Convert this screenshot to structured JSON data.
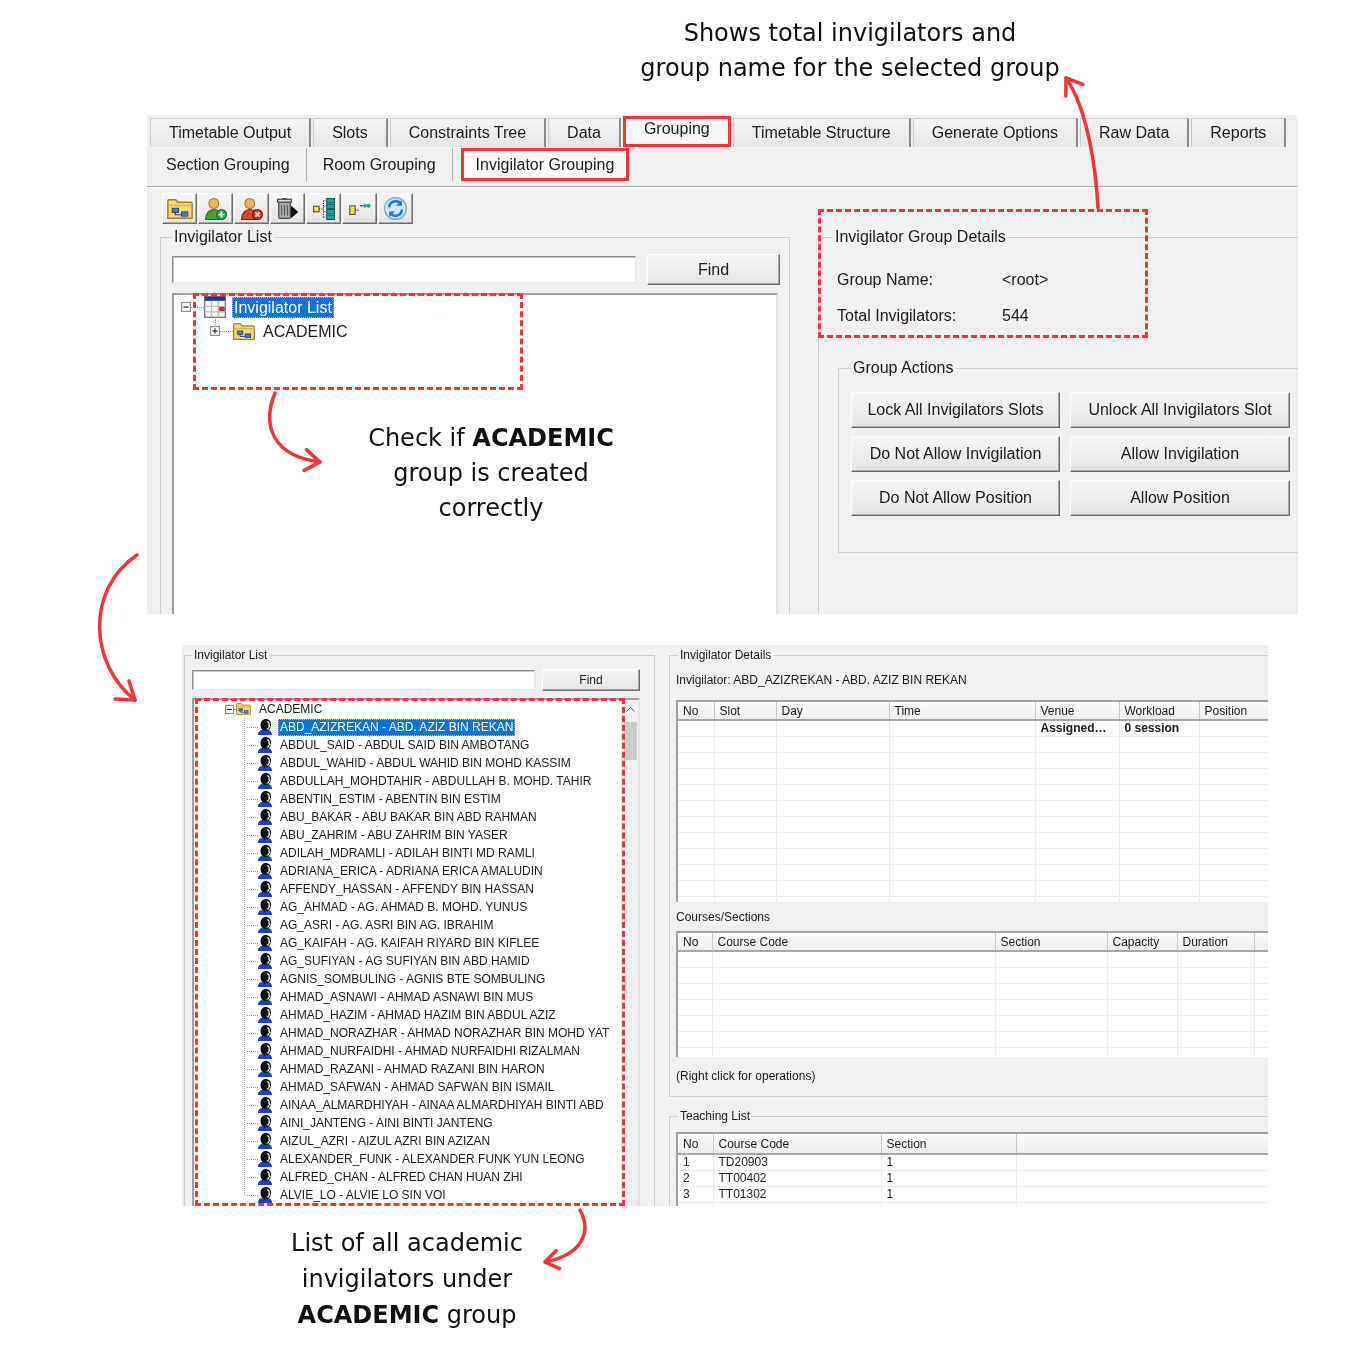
{
  "callout_top": {
    "lines": [
      "Shows total invigilators and",
      "group name for the selected group"
    ]
  },
  "screen_1": {
    "tabs": [
      {
        "label": "Timetable Output",
        "selected": false,
        "highlighted": false
      },
      {
        "label": "Slots",
        "selected": false,
        "highlighted": false
      },
      {
        "label": "Constraints Tree",
        "selected": false,
        "highlighted": false
      },
      {
        "label": "Data",
        "selected": false,
        "highlighted": false
      },
      {
        "label": "Grouping",
        "selected": true,
        "highlighted": true
      },
      {
        "label": "Timetable Structure",
        "selected": false,
        "highlighted": false
      },
      {
        "label": "Generate Options",
        "selected": false,
        "highlighted": false
      },
      {
        "label": "Raw Data",
        "selected": false,
        "highlighted": false
      },
      {
        "label": "Reports",
        "selected": false,
        "highlighted": false
      }
    ],
    "subtabs": [
      {
        "label": "Section Grouping",
        "selected": false,
        "highlighted": false
      },
      {
        "label": "Room Grouping",
        "selected": false,
        "highlighted": false
      },
      {
        "label": "Invigilator Grouping",
        "selected": true,
        "highlighted": true
      }
    ],
    "invigilator_list": {
      "title": "Invigilator List",
      "find_button": "Find",
      "tree_highlighted": true,
      "tree": [
        {
          "kind": "list",
          "label": "Invigilator List",
          "selected": true,
          "expanded": true,
          "children": [
            {
              "kind": "group",
              "label": "ACADEMIC",
              "selected": false,
              "expanded": false
            }
          ]
        }
      ],
      "callout": {
        "lines": [
          "Check if **ACADEMIC**",
          "group is created",
          "correctly"
        ]
      }
    },
    "group_details": {
      "title": "Invigilator Group Details",
      "highlighted": true,
      "fields": [
        {
          "label": "Group Name:",
          "value": "<root>"
        },
        {
          "label": "Total Invigilators:",
          "value": "544"
        }
      ]
    },
    "group_actions": {
      "title": "Group Actions",
      "buttons": [
        "Lock All Invigilators Slots",
        "Unlock All Invigilators Slot",
        "Do Not Allow Invigilation",
        "Allow Invigilation",
        "Do Not Allow Position",
        "Allow Position"
      ]
    }
  },
  "screen_2": {
    "invigilator_list": {
      "title": "Invigilator List",
      "find_button": "Find",
      "tree_highlighted": true,
      "tree": [
        {
          "kind": "group",
          "label": "ACADEMIC",
          "selected": false,
          "expanded": true,
          "children": [
            {
              "kind": "person",
              "label": "ABD_AZIZREKAN - ABD. AZIZ BIN REKAN",
              "selected": true
            },
            {
              "kind": "person",
              "label": "ABDUL_SAID - ABDUL SAID BIN AMBOTANG",
              "selected": false
            },
            {
              "kind": "person",
              "label": "ABDUL_WAHID - ABDUL WAHID BIN MOHD KASSIM",
              "selected": false
            },
            {
              "kind": "person",
              "label": "ABDULLAH_MOHDTAHIR - ABDULLAH B. MOHD. TAHIR",
              "selected": false
            },
            {
              "kind": "person",
              "label": "ABENTIN_ESTIM - ABENTIN BIN ESTIM",
              "selected": false
            },
            {
              "kind": "person",
              "label": "ABU_BAKAR - ABU BAKAR BIN ABD RAHMAN",
              "selected": false
            },
            {
              "kind": "person",
              "label": "ABU_ZAHRIM - ABU ZAHRIM BIN YASER",
              "selected": false
            },
            {
              "kind": "person",
              "label": "ADILAH_MDRAMLI - ADILAH BINTI MD RAMLI",
              "selected": false
            },
            {
              "kind": "person",
              "label": "ADRIANA_ERICA - ADRIANA ERICA AMALUDIN",
              "selected": false
            },
            {
              "kind": "person",
              "label": "AFFENDY_HASSAN - AFFENDY BIN HASSAN",
              "selected": false
            },
            {
              "kind": "person",
              "label": "AG_AHMAD - AG. AHMAD B. MOHD. YUNUS",
              "selected": false
            },
            {
              "kind": "person",
              "label": "AG_ASRI - AG. ASRI BIN AG. IBRAHIM",
              "selected": false
            },
            {
              "kind": "person",
              "label": "AG_KAIFAH - AG. KAIFAH RIYARD BIN KIFLEE",
              "selected": false
            },
            {
              "kind": "person",
              "label": "AG_SUFIYAN - AG SUFIYAN BIN ABD HAMID",
              "selected": false
            },
            {
              "kind": "person",
              "label": "AGNIS_SOMBULING - AGNIS BTE SOMBULING",
              "selected": false
            },
            {
              "kind": "person",
              "label": "AHMAD_ASNAWI - AHMAD ASNAWI BIN MUS",
              "selected": false
            },
            {
              "kind": "person",
              "label": "AHMAD_HAZIM - AHMAD HAZIM BIN ABDUL AZIZ",
              "selected": false
            },
            {
              "kind": "person",
              "label": "AHMAD_NORAZHAR - AHMAD NORAZHAR BIN MOHD YAT",
              "selected": false
            },
            {
              "kind": "person",
              "label": "AHMAD_NURFAIDHI - AHMAD NURFAIDHI RIZALMAN",
              "selected": false
            },
            {
              "kind": "person",
              "label": "AHMAD_RAZANI - AHMAD RAZANI BIN HARON",
              "selected": false
            },
            {
              "kind": "person",
              "label": "AHMAD_SAFWAN - AHMAD SAFWAN BIN ISMAIL",
              "selected": false
            },
            {
              "kind": "person",
              "label": "AINAA_ALMARDHIYAH - AINAA ALMARDHIYAH BINTI ABD",
              "selected": false
            },
            {
              "kind": "person",
              "label": "AINI_JANTENG - AINI BINTI JANTENG",
              "selected": false
            },
            {
              "kind": "person",
              "label": "AIZUL_AZRI - AIZUL AZRI BIN AZIZAN",
              "selected": false
            },
            {
              "kind": "person",
              "label": "ALEXANDER_FUNK - ALEXANDER FUNK YUN LEONG",
              "selected": false
            },
            {
              "kind": "person",
              "label": "ALFRED_CHAN - ALFRED CHAN HUAN ZHI",
              "selected": false
            },
            {
              "kind": "person",
              "label": "ALVIE_LO - ALVIE LO SIN VOI",
              "selected": false
            }
          ]
        }
      ]
    },
    "invigilator_details": {
      "title": "Invigilator Details",
      "invigilator": "Invigilator: ABD_AZIZREKAN - ABD. AZIZ BIN REKAN",
      "schedule": {
        "columns": [
          "No",
          "Slot",
          "Day",
          "Time",
          "Venue",
          "Workload",
          "Position"
        ],
        "summary": {
          "venue": "Assigned…",
          "workload": "0 session"
        }
      },
      "courses": {
        "title": "Courses/Sections",
        "columns": [
          "No",
          "Course Code",
          "Section",
          "Capacity",
          "Duration"
        ]
      },
      "hint": "(Right click for operations)"
    },
    "teaching_list": {
      "title": "Teaching List",
      "columns": [
        "No",
        "Course Code",
        "Section"
      ],
      "rows": [
        [
          "1",
          "TD20903",
          "1"
        ],
        [
          "2",
          "TT00402",
          "1"
        ],
        [
          "3",
          "TT01302",
          "1"
        ]
      ]
    }
  },
  "callout_bottom": {
    "lines": [
      "List of all academic",
      "invigilators under",
      "**ACADEMIC** group"
    ]
  }
}
